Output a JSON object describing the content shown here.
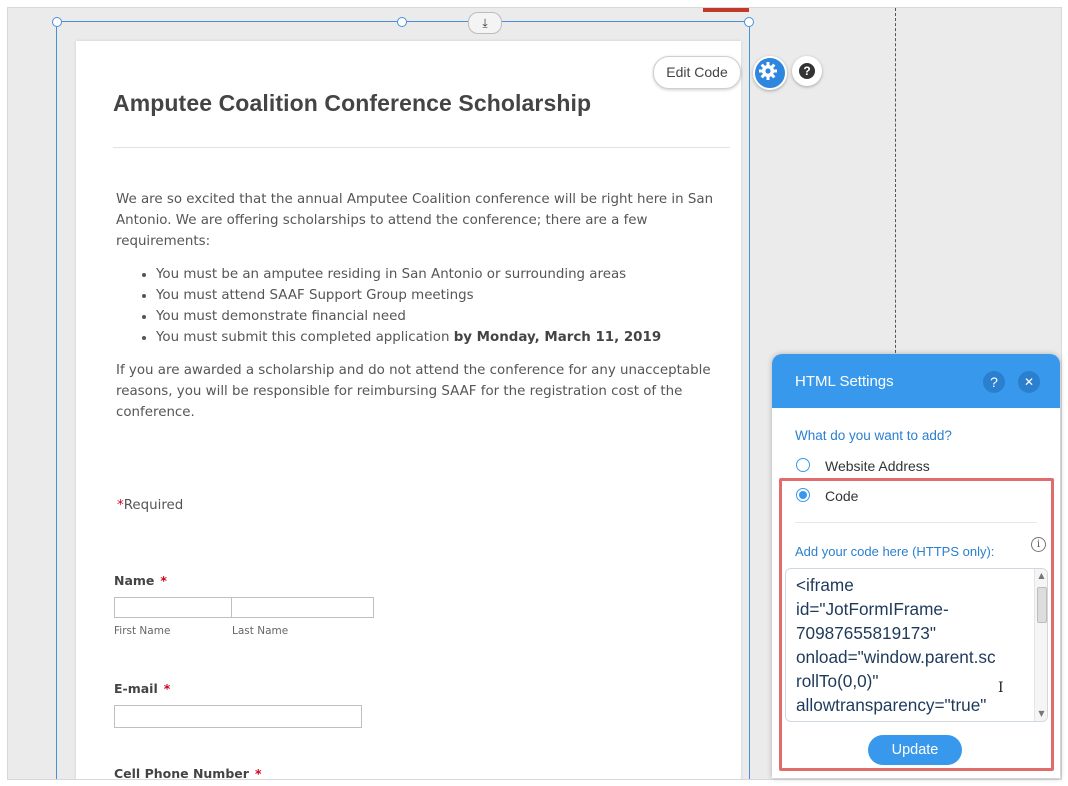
{
  "editor": {
    "anchor_icon": "download-arrow-icon",
    "edit_code_label": "Edit Code",
    "settings_icon": "gear-icon",
    "help_icon": "question-icon",
    "help_glyph": "?"
  },
  "form": {
    "title": "Amputee Coalition Conference Scholarship",
    "intro": "We are so excited that the annual Amputee Coalition conference will be right here in San Antonio. We are offering scholarships to attend the conference; there are a few requirements:",
    "requirements": [
      "You must be an amputee residing in San Antonio or surrounding areas",
      "You must attend SAAF Support Group meetings",
      "You must demonstrate financial need",
      "You must submit this completed application "
    ],
    "deadline_bold": "by Monday, March 11, 2019",
    "outro": "If you are awarded a scholarship and do not attend the conference for any unacceptable reasons, you will be responsible for reimbursing SAAF for the registration cost of the conference.",
    "required_star": "*",
    "required_note": "Required",
    "name_label": "Name",
    "first_name_sub": "First Name",
    "last_name_sub": "Last Name",
    "email_label": "E-mail",
    "cell_label": "Cell Phone Number",
    "star": "*"
  },
  "panel": {
    "title": "HTML Settings",
    "help_glyph": "?",
    "close_glyph": "✕",
    "question": "What do you want to add?",
    "option_website": "Website Address",
    "option_code": "Code",
    "selected": "Code",
    "code_label": "Add your code here (HTTPS only):",
    "info_glyph": "i",
    "code_value": "<iframe\nid=\"JotFormIFrame-\n70987655819173\"\nonload=\"window.parent.sc\nrollTo(0,0)\"\nallowtransparency=\"true\"",
    "update_label": "Update",
    "scroll_up": "▲",
    "scroll_down": "▼",
    "cursor": "I"
  }
}
